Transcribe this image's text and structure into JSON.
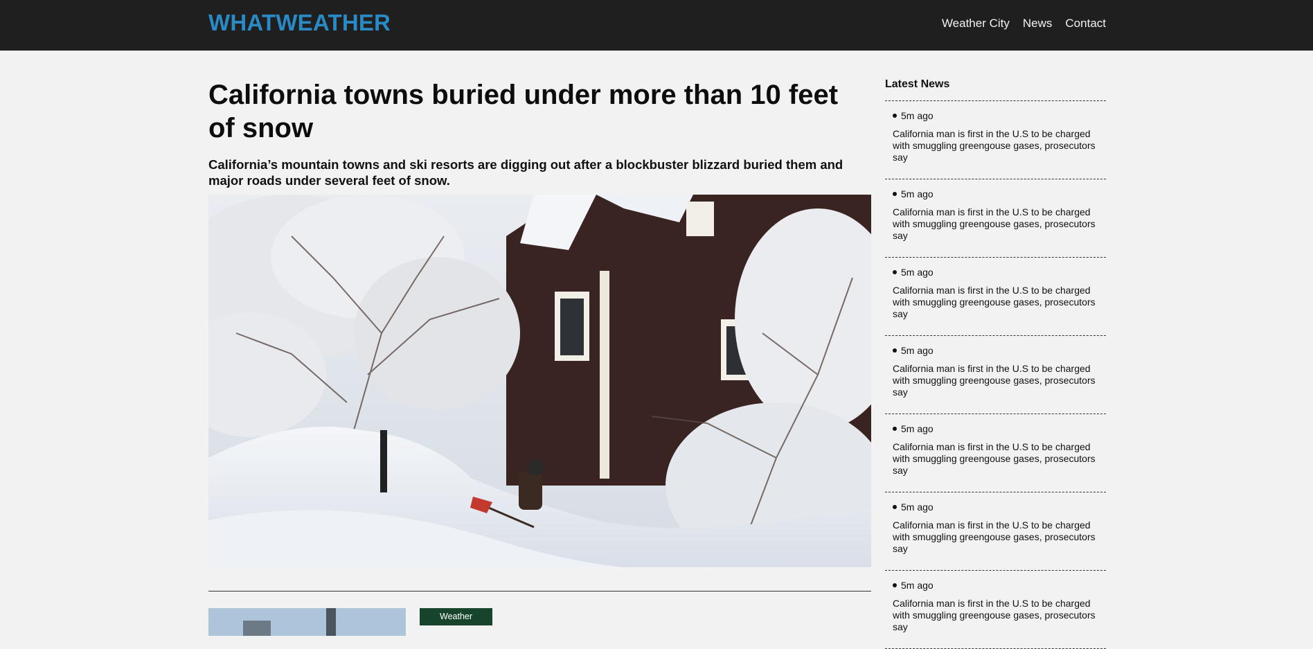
{
  "header": {
    "brand": "WHATWEATHER",
    "nav": [
      "Weather City",
      "News",
      "Contact"
    ]
  },
  "article": {
    "title": "California towns buried under more than 10 feet of snow",
    "subtitle": "California’s mountain towns and ski resorts are digging out after a blockbuster blizzard buried them and major roads under several feet of snow.",
    "image_icon": "snow-house-photo"
  },
  "teaser": {
    "category": "Weather"
  },
  "sidebar": {
    "title": "Latest News",
    "items": [
      {
        "time": "5m ago",
        "text": "California man is first in the U.S to be charged with smuggling greengouse gases, prosecutors say"
      },
      {
        "time": "5m ago",
        "text": "California man is first in the U.S to be charged with smuggling greengouse gases, prosecutors say"
      },
      {
        "time": "5m ago",
        "text": "California man is first in the U.S to be charged with smuggling greengouse gases, prosecutors say"
      },
      {
        "time": "5m ago",
        "text": "California man is first in the U.S to be charged with smuggling greengouse gases, prosecutors say"
      },
      {
        "time": "5m ago",
        "text": "California man is first in the U.S to be charged with smuggling greengouse gases, prosecutors say"
      },
      {
        "time": "5m ago",
        "text": "California man is first in the U.S to be charged with smuggling greengouse gases, prosecutors say"
      },
      {
        "time": "5m ago",
        "text": "California man is first in the U.S to be charged with smuggling greengouse gases, prosecutors say"
      }
    ]
  },
  "colors": {
    "brand": "#2a8ac6",
    "header_bg": "#1f1f1f",
    "page_bg": "#f2f2f2",
    "tag_bg": "#17452c"
  }
}
